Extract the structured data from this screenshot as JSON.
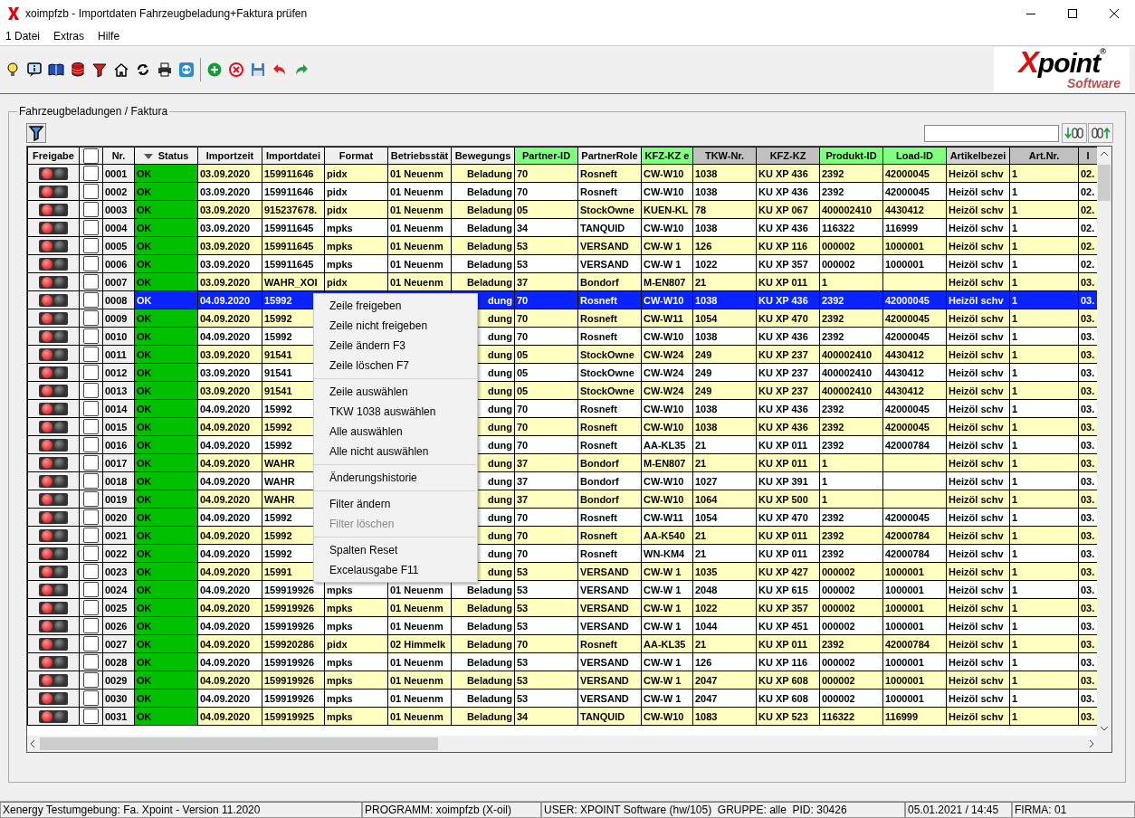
{
  "window": {
    "title": "xoimpfzb - Importdaten Fahrzeugbeladung+Faktura prüfen"
  },
  "menu": [
    "1 Datei",
    "Extras",
    "Hilfe"
  ],
  "logo": {
    "main": "Xpoint",
    "sub": "Software",
    "mark": "®"
  },
  "group": {
    "title": "Fahrzeugbeladungen / Faktura"
  },
  "table": {
    "columns": [
      {
        "label": "Freigabe",
        "sorted": false,
        "color": "#f0f0f0"
      },
      {
        "kind": "checkbox",
        "checked": false,
        "sorted": false
      },
      {
        "label": "Nr.",
        "sorted": false,
        "color": "#f0f0f0"
      },
      {
        "label": "Status",
        "sorted": true,
        "color": "#f0f0f0"
      },
      {
        "label": "Importzeit",
        "sorted": false,
        "color": "#f0f0f0"
      },
      {
        "label": "Importdatei",
        "sorted": false,
        "color": "#f0f0f0"
      },
      {
        "label": "Format",
        "sorted": false,
        "color": "#f0f0f0"
      },
      {
        "label": "Betriebsstät",
        "sorted": false,
        "color": "#f0f0f0"
      },
      {
        "label": "Bewegungs",
        "sorted": false,
        "color": "#f0f0f0"
      },
      {
        "label": "Partner-ID",
        "sorted": false,
        "color": "#80ff80"
      },
      {
        "label": "PartnerRole",
        "sorted": false,
        "color": "#f0f0f0"
      },
      {
        "label": "KFZ-KZ e",
        "sorted": false,
        "color": "#80ff80"
      },
      {
        "label": "TKW-Nr.",
        "sorted": false,
        "color": "#c0c0c0"
      },
      {
        "label": "KFZ-KZ",
        "sorted": false,
        "color": "#c0c0c0"
      },
      {
        "label": "Produkt-ID",
        "sorted": false,
        "color": "#80ff80"
      },
      {
        "label": "Load-ID",
        "sorted": false,
        "color": "#80ff80"
      },
      {
        "label": "Artikelbezei",
        "sorted": false,
        "color": "#d4d4d4"
      },
      {
        "label": "Art.Nr.",
        "sorted": false,
        "color": "#c0c0c0"
      },
      {
        "label": "I",
        "sorted": false,
        "color": "#c0c0c0"
      }
    ],
    "rows": [
      {
        "selected": false,
        "checked": false,
        "cells": [
          "",
          "",
          "0001",
          "OK",
          "03.09.2020",
          "159911646",
          "pidx",
          "01 Neuenm",
          "Beladung",
          "70",
          "Rosneft",
          "CW-W10",
          "1038",
          "KU XP 436",
          "2392",
          "42000045",
          "Heizöl schv",
          "1",
          "02."
        ]
      },
      {
        "selected": false,
        "checked": false,
        "cells": [
          "",
          "",
          "0002",
          "OK",
          "03.09.2020",
          "159911646",
          "pidx",
          "01 Neuenm",
          "Beladung",
          "70",
          "Rosneft",
          "CW-W10",
          "1038",
          "KU XP 436",
          "2392",
          "42000045",
          "Heizöl schv",
          "1",
          "02."
        ]
      },
      {
        "selected": false,
        "checked": false,
        "cells": [
          "",
          "",
          "0003",
          "OK",
          "03.09.2020",
          "915237678.",
          "pidx",
          "01 Neuenm",
          "Beladung",
          "05",
          "StockOwne",
          "KUEN-KL",
          "78",
          "KU XP 067",
          "400002410",
          "4430412",
          "Heizöl schv",
          "1",
          "02."
        ]
      },
      {
        "selected": false,
        "checked": false,
        "cells": [
          "",
          "",
          "0004",
          "OK",
          "03.09.2020",
          "159911645",
          "mpks",
          "01 Neuenm",
          "Beladung",
          "34",
          "TANQUID",
          "CW-W10",
          "1038",
          "KU XP 436",
          "116322",
          "116999",
          "Heizöl schv",
          "1",
          "02."
        ]
      },
      {
        "selected": false,
        "checked": false,
        "cells": [
          "",
          "",
          "0005",
          "OK",
          "03.09.2020",
          "159911645",
          "mpks",
          "01 Neuenm",
          "Beladung",
          "53",
          "VERSAND",
          "CW-W 1",
          "126",
          "KU XP 116",
          "000002",
          "1000001",
          "Heizöl schv",
          "1",
          "02."
        ]
      },
      {
        "selected": false,
        "checked": false,
        "cells": [
          "",
          "",
          "0006",
          "OK",
          "03.09.2020",
          "159911645",
          "mpks",
          "01 Neuenm",
          "Beladung",
          "53",
          "VERSAND",
          "CW-W 1",
          "1022",
          "KU XP 357",
          "000002",
          "1000001",
          "Heizöl schv",
          "1",
          "02."
        ]
      },
      {
        "selected": false,
        "checked": false,
        "cells": [
          "",
          "",
          "0007",
          "OK",
          "03.09.2020",
          "WAHR_XOI",
          "pidx",
          "01 Neuenm",
          "Beladung",
          "37",
          "Bondorf",
          "M-EN807",
          "21",
          "KU XP 011",
          "1",
          null,
          "Heizöl schv",
          "1",
          "03."
        ]
      },
      {
        "selected": true,
        "checked": false,
        "cells": [
          "",
          "",
          "0008",
          "OK",
          "04.09.2020",
          "15992",
          null,
          null,
          "dung",
          "70",
          "Rosneft",
          "CW-W10",
          "1038",
          "KU XP 436",
          "2392",
          "42000045",
          "Heizöl schv",
          "1",
          "03."
        ]
      },
      {
        "selected": false,
        "checked": false,
        "cells": [
          "",
          "",
          "0009",
          "OK",
          "04.09.2020",
          "15992",
          null,
          null,
          "dung",
          "70",
          "Rosneft",
          "CW-W11",
          "1054",
          "KU XP 470",
          "2392",
          "42000045",
          "Heizöl schv",
          "1",
          "03."
        ]
      },
      {
        "selected": false,
        "checked": false,
        "cells": [
          "",
          "",
          "0010",
          "OK",
          "04.09.2020",
          "15992",
          null,
          null,
          "dung",
          "70",
          "Rosneft",
          "CW-W10",
          "1038",
          "KU XP 436",
          "2392",
          "42000045",
          "Heizöl schv",
          "1",
          "03."
        ]
      },
      {
        "selected": false,
        "checked": false,
        "cells": [
          "",
          "",
          "0011",
          "OK",
          "03.09.2020",
          "91541",
          null,
          null,
          "dung",
          "05",
          "StockOwne",
          "CW-W24",
          "249",
          "KU XP 237",
          "400002410",
          "4430412",
          "Heizöl schv",
          "1",
          "03."
        ]
      },
      {
        "selected": false,
        "checked": false,
        "cells": [
          "",
          "",
          "0012",
          "OK",
          "03.09.2020",
          "91541",
          null,
          null,
          "dung",
          "05",
          "StockOwne",
          "CW-W24",
          "249",
          "KU XP 237",
          "400002410",
          "4430412",
          "Heizöl schv",
          "1",
          "03."
        ]
      },
      {
        "selected": false,
        "checked": false,
        "cells": [
          "",
          "",
          "0013",
          "OK",
          "03.09.2020",
          "91541",
          null,
          null,
          "dung",
          "05",
          "StockOwne",
          "CW-W24",
          "249",
          "KU XP 237",
          "400002410",
          "4430412",
          "Heizöl schv",
          "1",
          "03."
        ]
      },
      {
        "selected": false,
        "checked": false,
        "cells": [
          "",
          "",
          "0014",
          "OK",
          "04.09.2020",
          "15992",
          null,
          null,
          "dung",
          "70",
          "Rosneft",
          "CW-W10",
          "1038",
          "KU XP 436",
          "2392",
          "42000045",
          "Heizöl schv",
          "1",
          "03."
        ]
      },
      {
        "selected": false,
        "checked": false,
        "cells": [
          "",
          "",
          "0015",
          "OK",
          "04.09.2020",
          "15992",
          null,
          null,
          "dung",
          "70",
          "Rosneft",
          "CW-W10",
          "1038",
          "KU XP 436",
          "2392",
          "42000045",
          "Heizöl schv",
          "1",
          "03."
        ]
      },
      {
        "selected": false,
        "checked": false,
        "cells": [
          "",
          "",
          "0016",
          "OK",
          "04.09.2020",
          "15992",
          null,
          null,
          "dung",
          "70",
          "Rosneft",
          "AA-KL35",
          "21",
          "KU XP 011",
          "2392",
          "42000784",
          "Heizöl schv",
          "1",
          "03."
        ]
      },
      {
        "selected": false,
        "checked": false,
        "cells": [
          "",
          "",
          "0017",
          "OK",
          "04.09.2020",
          "WAHR",
          null,
          null,
          "dung",
          "37",
          "Bondorf",
          "M-EN807",
          "21",
          "KU XP 011",
          "1",
          null,
          "Heizöl schv",
          "1",
          "03."
        ]
      },
      {
        "selected": false,
        "checked": false,
        "cells": [
          "",
          "",
          "0018",
          "OK",
          "04.09.2020",
          "WAHR",
          null,
          null,
          "dung",
          "37",
          "Bondorf",
          "CW-W10",
          "1027",
          "KU XP 391",
          "1",
          null,
          "Heizöl schv",
          "1",
          "03."
        ]
      },
      {
        "selected": false,
        "checked": false,
        "cells": [
          "",
          "",
          "0019",
          "OK",
          "04.09.2020",
          "WAHR",
          null,
          null,
          "dung",
          "37",
          "Bondorf",
          "CW-W10",
          "1064",
          "KU XP 500",
          "1",
          null,
          "Heizöl schv",
          "1",
          "03."
        ]
      },
      {
        "selected": false,
        "checked": false,
        "cells": [
          "",
          "",
          "0020",
          "OK",
          "04.09.2020",
          "15992",
          null,
          null,
          "dung",
          "70",
          "Rosneft",
          "CW-W11",
          "1054",
          "KU XP 470",
          "2392",
          "42000045",
          "Heizöl schv",
          "1",
          "03."
        ]
      },
      {
        "selected": false,
        "checked": false,
        "cells": [
          "",
          "",
          "0021",
          "OK",
          "04.09.2020",
          "15992",
          null,
          null,
          "dung",
          "70",
          "Rosneft",
          "AA-K540",
          "21",
          "KU XP 011",
          "2392",
          "42000784",
          "Heizöl schv",
          "1",
          "03."
        ]
      },
      {
        "selected": false,
        "checked": false,
        "cells": [
          "",
          "",
          "0022",
          "OK",
          "04.09.2020",
          "15992",
          null,
          null,
          "dung",
          "70",
          "Rosneft",
          "WN-KM4",
          "21",
          "KU XP 011",
          "2392",
          "42000784",
          "Heizöl schv",
          "1",
          "03."
        ]
      },
      {
        "selected": false,
        "checked": false,
        "cells": [
          "",
          "",
          "0023",
          "OK",
          "04.09.2020",
          "15991",
          null,
          null,
          "dung",
          "53",
          "VERSAND",
          "CW-W 1",
          "1035",
          "KU XP 427",
          "000002",
          "1000001",
          "Heizöl schv",
          "1",
          "03."
        ]
      },
      {
        "selected": false,
        "checked": false,
        "cells": [
          "",
          "",
          "0024",
          "OK",
          "04.09.2020",
          "159919926",
          "mpks",
          "01 Neuenm",
          "Beladung",
          "53",
          "VERSAND",
          "CW-W 1",
          "2048",
          "KU XP 615",
          "000002",
          "1000001",
          "Heizöl schv",
          "1",
          "03."
        ]
      },
      {
        "selected": false,
        "checked": false,
        "cells": [
          "",
          "",
          "0025",
          "OK",
          "04.09.2020",
          "159919926",
          "mpks",
          "01 Neuenm",
          "Beladung",
          "53",
          "VERSAND",
          "CW-W 1",
          "1022",
          "KU XP 357",
          "000002",
          "1000001",
          "Heizöl schv",
          "1",
          "03."
        ]
      },
      {
        "selected": false,
        "checked": false,
        "cells": [
          "",
          "",
          "0026",
          "OK",
          "04.09.2020",
          "159919926",
          "mpks",
          "01 Neuenm",
          "Beladung",
          "53",
          "VERSAND",
          "CW-W 1",
          "1044",
          "KU XP 451",
          "000002",
          "1000001",
          "Heizöl schv",
          "1",
          "03."
        ]
      },
      {
        "selected": false,
        "checked": false,
        "cells": [
          "",
          "",
          "0027",
          "OK",
          "04.09.2020",
          "159920286",
          "pidx",
          "02 Himmelk",
          "Beladung",
          "70",
          "Rosneft",
          "AA-KL35",
          "21",
          "KU XP 011",
          "2392",
          "42000784",
          "Heizöl schv",
          "1",
          "03."
        ]
      },
      {
        "selected": false,
        "checked": false,
        "cells": [
          "",
          "",
          "0028",
          "OK",
          "04.09.2020",
          "159919926",
          "mpks",
          "01 Neuenm",
          "Beladung",
          "53",
          "VERSAND",
          "CW-W 1",
          "126",
          "KU XP 116",
          "000002",
          "1000001",
          "Heizöl schv",
          "1",
          "03."
        ]
      },
      {
        "selected": false,
        "checked": false,
        "cells": [
          "",
          "",
          "0029",
          "OK",
          "04.09.2020",
          "159919926",
          "mpks",
          "01 Neuenm",
          "Beladung",
          "53",
          "VERSAND",
          "CW-W 1",
          "2047",
          "KU XP 608",
          "000002",
          "1000001",
          "Heizöl schv",
          "1",
          "03."
        ]
      },
      {
        "selected": false,
        "checked": false,
        "cells": [
          "",
          "",
          "0030",
          "OK",
          "04.09.2020",
          "159919926",
          "mpks",
          "01 Neuenm",
          "Beladung",
          "53",
          "VERSAND",
          "CW-W 1",
          "2047",
          "KU XP 608",
          "000002",
          "1000001",
          "Heizöl schv",
          "1",
          "03."
        ]
      },
      {
        "selected": false,
        "checked": false,
        "cells": [
          "",
          "",
          "0031",
          "OK",
          "04.09.2020",
          "159919925",
          "mpks",
          "01 Neuenm",
          "Beladung",
          "34",
          "TANQUID",
          "CW-W10",
          "1083",
          "KU XP 523",
          "116322",
          "116999",
          "Heizöl schv",
          "1",
          "03."
        ]
      }
    ]
  },
  "context_menu": [
    [
      {
        "label": "Zeile freigeben",
        "disabled": false
      },
      {
        "label": "Zeile nicht freigeben",
        "disabled": false
      },
      {
        "label": "Zeile ändern F3",
        "disabled": false
      },
      {
        "label": "Zeile löschen F7",
        "disabled": false
      }
    ],
    [
      {
        "label": "Zeile auswählen",
        "disabled": false
      },
      {
        "label": "TKW 1038 auswählen",
        "disabled": false
      },
      {
        "label": "Alle auswählen",
        "disabled": false
      },
      {
        "label": "Alle nicht auswählen",
        "disabled": false
      }
    ],
    [
      {
        "label": "Änderungshistorie",
        "disabled": false
      }
    ],
    [
      {
        "label": "Filter ändern",
        "disabled": false
      },
      {
        "label": "Filter löschen",
        "disabled": true
      }
    ],
    [
      {
        "label": "Spalten Reset",
        "disabled": false
      },
      {
        "label": "Excelausgabe F11",
        "disabled": false
      }
    ]
  ],
  "status_bar": [
    "Xenergy Testumgebung: Fa. Xpoint - Version 11.2020",
    "PROGRAMM: xoimpfzb (X-oil)",
    "USER: XPOINT Software (hw/105)  GRUPPE: alle  PID: 30426",
    "05.01.2021 / 14:45",
    "FIRMA: 01"
  ]
}
